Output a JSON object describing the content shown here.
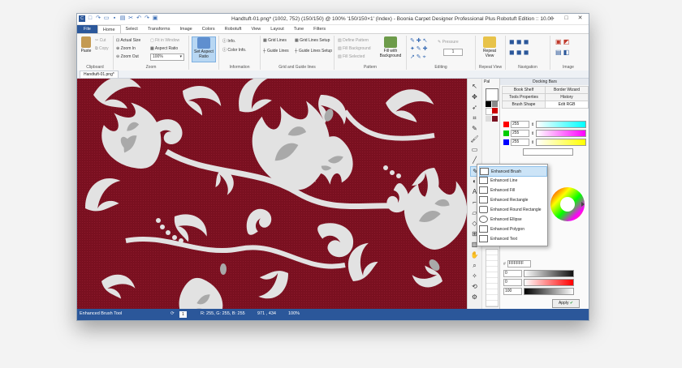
{
  "title": "Handtuft-01.png* (1002, 752) (150/150) @ 100% '150/150×1' (Index) - Boonia Carpet Designer Professional Plus Robotuft Edition :: 10.00",
  "tabs": [
    "File",
    "Home",
    "Select",
    "Transforms",
    "Image",
    "Colors",
    "Robotuft",
    "View",
    "Layout",
    "Tune",
    "Filters"
  ],
  "clipboard": {
    "paste": "Paste",
    "cut": "Cut",
    "copy": "Copy",
    "label": "Clipboard"
  },
  "zoom": {
    "actual_size": "Actual Size",
    "zoom_in": "Zoom In",
    "zoom_out": "Zoom Out",
    "fit_in_window": "Fit in Window",
    "aspect_ratio": "Aspect Ratio",
    "zoom_value": "100%",
    "label": "Zoom"
  },
  "aspect": {
    "set_label": "Set Aspect Ratio"
  },
  "information": {
    "info": "Info.",
    "color_info": "Color Info.",
    "label": "Information"
  },
  "grid": {
    "grid_lines": "Grid Lines",
    "grid_lines_setup": "Grid Lines Setup",
    "guide_lines": "Guide Lines",
    "guide_lines_setup": "Guide Lines Setup",
    "label": "Grid and Guide lines"
  },
  "pattern": {
    "define_pattern": "Define Pattern",
    "fill_background": "Fill Background",
    "fill_selected": "Fill Selected",
    "fill_with_background": "Fill with Background",
    "label": "Pattern"
  },
  "editing": {
    "pressure": "Pressure",
    "size_value": "1",
    "label": "Editing"
  },
  "repeat": {
    "repeat_view": "Repeat View",
    "label": "Repeat View"
  },
  "navigation": {
    "label": "Navigation"
  },
  "image_grp": {
    "label": "Image"
  },
  "doc_tab": "Handtuft-01.png*",
  "panel": {
    "pal_label": "Pal",
    "title": "Docking Bars",
    "tabs": [
      "Book Shelf",
      "Border Wizard",
      "Tools Properties",
      "History",
      "Brush Shape",
      "Edit RGB"
    ],
    "rgb": [
      {
        "value": "255",
        "color": "#ff0000",
        "grad": "linear-gradient(90deg,#fff,#00ffff)"
      },
      {
        "value": "255",
        "color": "#00cc00",
        "grad": "linear-gradient(90deg,#fff,#ff00ff)"
      },
      {
        "value": "255",
        "color": "#0000ff",
        "grad": "linear-gradient(90deg,#fff,#ffff00)"
      }
    ],
    "hex": "FFFFFF",
    "bottom_rows": [
      {
        "value": "0"
      },
      {
        "value": "0"
      },
      {
        "value": "100"
      }
    ],
    "apply": "Apply"
  },
  "menu_items": [
    "Enhanced Brush",
    "Enhanced Line",
    "Enhanced Fill",
    "Enhanced Rectangle",
    "Enhanced Round Rectangle",
    "Enhanced Ellipse",
    "Enhanced Polygon",
    "Enhanced Text"
  ],
  "status": {
    "tool": "Enhanced Brush Tool",
    "page": "1",
    "rgb": "R: 255, G: 255, B: 255",
    "coords": "971 , 434",
    "zoom": "100%"
  },
  "colors": {
    "accent": "#2b579a",
    "canvas": "#7a1020",
    "motif": "#e2e2e2",
    "motif_shade": "#a9a9a9"
  }
}
